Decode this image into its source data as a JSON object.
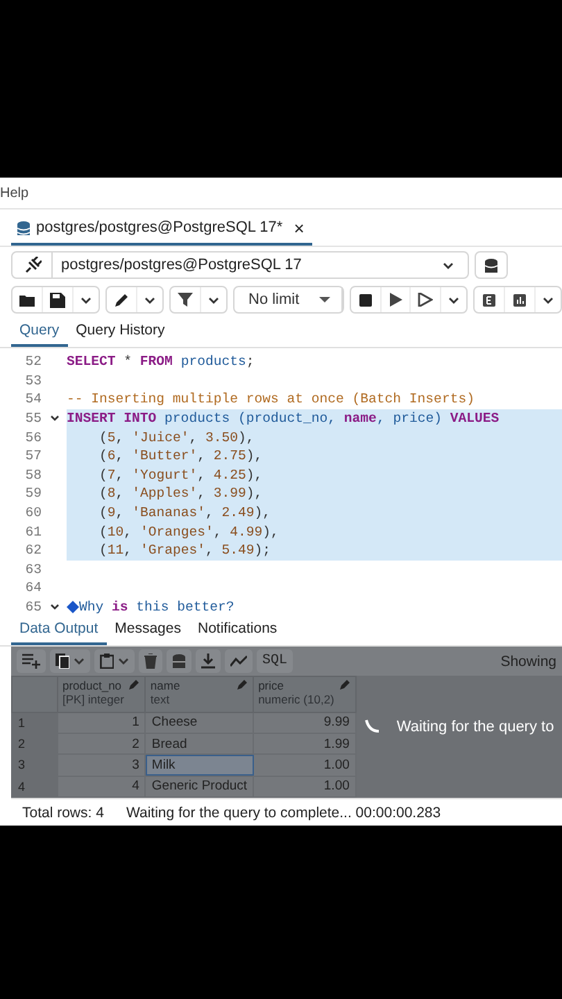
{
  "menu": {
    "items": [
      "Help"
    ]
  },
  "editor_tab": {
    "title": "postgres/postgres@PostgreSQL 17*",
    "close": "×"
  },
  "connection": {
    "value": "postgres/postgres@PostgreSQL 17"
  },
  "toolbar": {
    "limit": "No limit"
  },
  "query_tabs": [
    {
      "label": "Query",
      "selected": true
    },
    {
      "label": "Query History",
      "selected": false
    }
  ],
  "editor": {
    "lines": [
      {
        "number": "52",
        "selected": false,
        "foldable": false,
        "bullet": false,
        "tokens": [
          {
            "kind": "keyword",
            "text": "SELECT"
          },
          {
            "kind": "punct",
            "text": " * "
          },
          {
            "kind": "keyword",
            "text": "FROM"
          },
          {
            "kind": "ident",
            "text": " products"
          },
          {
            "kind": "punct",
            "text": ";"
          }
        ]
      },
      {
        "number": "53",
        "selected": false,
        "foldable": false,
        "bullet": false
      },
      {
        "number": "54",
        "selected": false,
        "foldable": false,
        "bullet": false,
        "tokens": [
          {
            "kind": "comment",
            "text": "-- Inserting multiple rows at once (Batch Inserts)"
          }
        ]
      },
      {
        "number": "55",
        "selected": true,
        "foldable": true,
        "bullet": false,
        "tokens": [
          {
            "kind": "keyword",
            "text": "INSERT INTO"
          },
          {
            "kind": "ident",
            "text": " products (product_no, "
          },
          {
            "kind": "keyword",
            "text": "name"
          },
          {
            "kind": "ident",
            "text": ", price) "
          },
          {
            "kind": "keyword",
            "text": "VALUES"
          }
        ]
      },
      {
        "number": "56",
        "selected": true,
        "foldable": false,
        "bullet": false,
        "tokens": [
          {
            "kind": "punct",
            "text": "    ("
          },
          {
            "kind": "number",
            "text": "5"
          },
          {
            "kind": "punct",
            "text": ", "
          },
          {
            "kind": "string",
            "text": "'Juice'"
          },
          {
            "kind": "punct",
            "text": ", "
          },
          {
            "kind": "number",
            "text": "3.50"
          },
          {
            "kind": "punct",
            "text": "),"
          }
        ]
      },
      {
        "number": "57",
        "selected": true,
        "foldable": false,
        "bullet": false,
        "tokens": [
          {
            "kind": "punct",
            "text": "    ("
          },
          {
            "kind": "number",
            "text": "6"
          },
          {
            "kind": "punct",
            "text": ", "
          },
          {
            "kind": "string",
            "text": "'Butter'"
          },
          {
            "kind": "punct",
            "text": ", "
          },
          {
            "kind": "number",
            "text": "2.75"
          },
          {
            "kind": "punct",
            "text": "),"
          }
        ]
      },
      {
        "number": "58",
        "selected": true,
        "foldable": false,
        "bullet": false,
        "tokens": [
          {
            "kind": "punct",
            "text": "    ("
          },
          {
            "kind": "number",
            "text": "7"
          },
          {
            "kind": "punct",
            "text": ", "
          },
          {
            "kind": "string",
            "text": "'Yogurt'"
          },
          {
            "kind": "punct",
            "text": ", "
          },
          {
            "kind": "number",
            "text": "4.25"
          },
          {
            "kind": "punct",
            "text": "),"
          }
        ]
      },
      {
        "number": "59",
        "selected": true,
        "foldable": false,
        "bullet": false,
        "tokens": [
          {
            "kind": "punct",
            "text": "    ("
          },
          {
            "kind": "number",
            "text": "8"
          },
          {
            "kind": "punct",
            "text": ", "
          },
          {
            "kind": "string",
            "text": "'Apples'"
          },
          {
            "kind": "punct",
            "text": ", "
          },
          {
            "kind": "number",
            "text": "3.99"
          },
          {
            "kind": "punct",
            "text": "),"
          }
        ]
      },
      {
        "number": "60",
        "selected": true,
        "foldable": false,
        "bullet": false,
        "tokens": [
          {
            "kind": "punct",
            "text": "    ("
          },
          {
            "kind": "number",
            "text": "9"
          },
          {
            "kind": "punct",
            "text": ", "
          },
          {
            "kind": "string",
            "text": "'Bananas'"
          },
          {
            "kind": "punct",
            "text": ", "
          },
          {
            "kind": "number",
            "text": "2.49"
          },
          {
            "kind": "punct",
            "text": "),"
          }
        ]
      },
      {
        "number": "61",
        "selected": true,
        "foldable": false,
        "bullet": false,
        "tokens": [
          {
            "kind": "punct",
            "text": "    ("
          },
          {
            "kind": "number",
            "text": "10"
          },
          {
            "kind": "punct",
            "text": ", "
          },
          {
            "kind": "string",
            "text": "'Oranges'"
          },
          {
            "kind": "punct",
            "text": ", "
          },
          {
            "kind": "number",
            "text": "4.99"
          },
          {
            "kind": "punct",
            "text": "),"
          }
        ]
      },
      {
        "number": "62",
        "selected": true,
        "foldable": false,
        "bullet": false,
        "tokens": [
          {
            "kind": "punct",
            "text": "    ("
          },
          {
            "kind": "number",
            "text": "11"
          },
          {
            "kind": "punct",
            "text": ", "
          },
          {
            "kind": "string",
            "text": "'Grapes'"
          },
          {
            "kind": "punct",
            "text": ", "
          },
          {
            "kind": "number",
            "text": "5.49"
          },
          {
            "kind": "punct",
            "text": ");"
          }
        ]
      },
      {
        "number": "63",
        "selected": false,
        "foldable": false,
        "bullet": false
      },
      {
        "number": "64",
        "selected": false,
        "foldable": false,
        "bullet": false
      },
      {
        "number": "65",
        "selected": false,
        "foldable": true,
        "bullet": true,
        "tokens": [
          {
            "kind": "ident",
            "text": "Why "
          },
          {
            "kind": "keyword",
            "text": "is"
          },
          {
            "kind": "ident",
            "text": " this better?"
          }
        ]
      }
    ]
  },
  "result_tabs": [
    {
      "label": "Data Output",
      "selected": true
    },
    {
      "label": "Messages",
      "selected": false
    },
    {
      "label": "Notifications",
      "selected": false
    }
  ],
  "result_toolbar": {
    "sql_button": "SQL",
    "showing": "Showing"
  },
  "grid": {
    "loading": true,
    "loading_text": "Waiting for the query to",
    "columns": [
      {
        "name": "product_no",
        "type": "[PK] integer"
      },
      {
        "name": "name",
        "type": "text"
      },
      {
        "name": "price",
        "type": "numeric (10,2)"
      }
    ],
    "rows": [
      {
        "number": "1",
        "cells": [
          {
            "text": "1",
            "selected": false
          },
          {
            "text": "Cheese",
            "selected": false
          },
          {
            "text": "9.99",
            "selected": false
          }
        ]
      },
      {
        "number": "2",
        "cells": [
          {
            "text": "2",
            "selected": false
          },
          {
            "text": "Bread",
            "selected": false
          },
          {
            "text": "1.99",
            "selected": false
          }
        ]
      },
      {
        "number": "3",
        "cells": [
          {
            "text": "3",
            "selected": false
          },
          {
            "text": "Milk",
            "selected": true
          },
          {
            "text": "1.00",
            "selected": false
          }
        ]
      },
      {
        "number": "4",
        "cells": [
          {
            "text": "4",
            "selected": false
          },
          {
            "text": "Generic Product",
            "selected": false
          },
          {
            "text": "1.00",
            "selected": false
          }
        ]
      }
    ]
  },
  "status_bar": {
    "total": "Total rows: 4",
    "message": "Waiting for the query to complete... 00:00:00.283"
  }
}
